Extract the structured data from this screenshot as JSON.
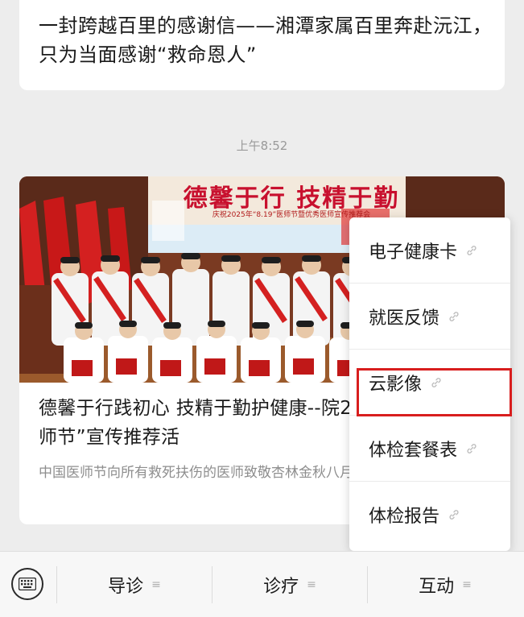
{
  "top_article": {
    "title": "一封跨越百里的感谢信——湘潭家属百里奔赴沅江，只为当面感谢“救命恩人”"
  },
  "timestamp": "上午8:52",
  "main_article": {
    "cover": {
      "banner_title": "德馨于行 技精于勤",
      "banner_subtitle": "庆祝2025年“8.19”医师节暨优秀医师宣传推荐会"
    },
    "title": "德馨于行践初心 技精于勤护健康--院2025年“中国医师节”宣传推荐活",
    "summary": "中国医师节向所有救死扶伤的医师致敬杏林金秋八月，丹桂飘香。"
  },
  "popup_menu": {
    "items": [
      {
        "label": "电子健康卡",
        "icon": "link-icon"
      },
      {
        "label": "就医反馈",
        "icon": "link-icon"
      },
      {
        "label": "云影像",
        "icon": "link-icon",
        "highlighted": true
      },
      {
        "label": "体检套餐表",
        "icon": "link-icon"
      },
      {
        "label": "体检报告",
        "icon": "link-icon"
      }
    ],
    "highlight_color": "#d81e1e"
  },
  "bottom_bar": {
    "keyboard_icon": "keyboard-icon",
    "tabs": [
      {
        "label": "导诊",
        "menu_glyph": "≡"
      },
      {
        "label": "诊疗",
        "menu_glyph": "≡"
      },
      {
        "label": "互动",
        "menu_glyph": "≡"
      }
    ]
  }
}
